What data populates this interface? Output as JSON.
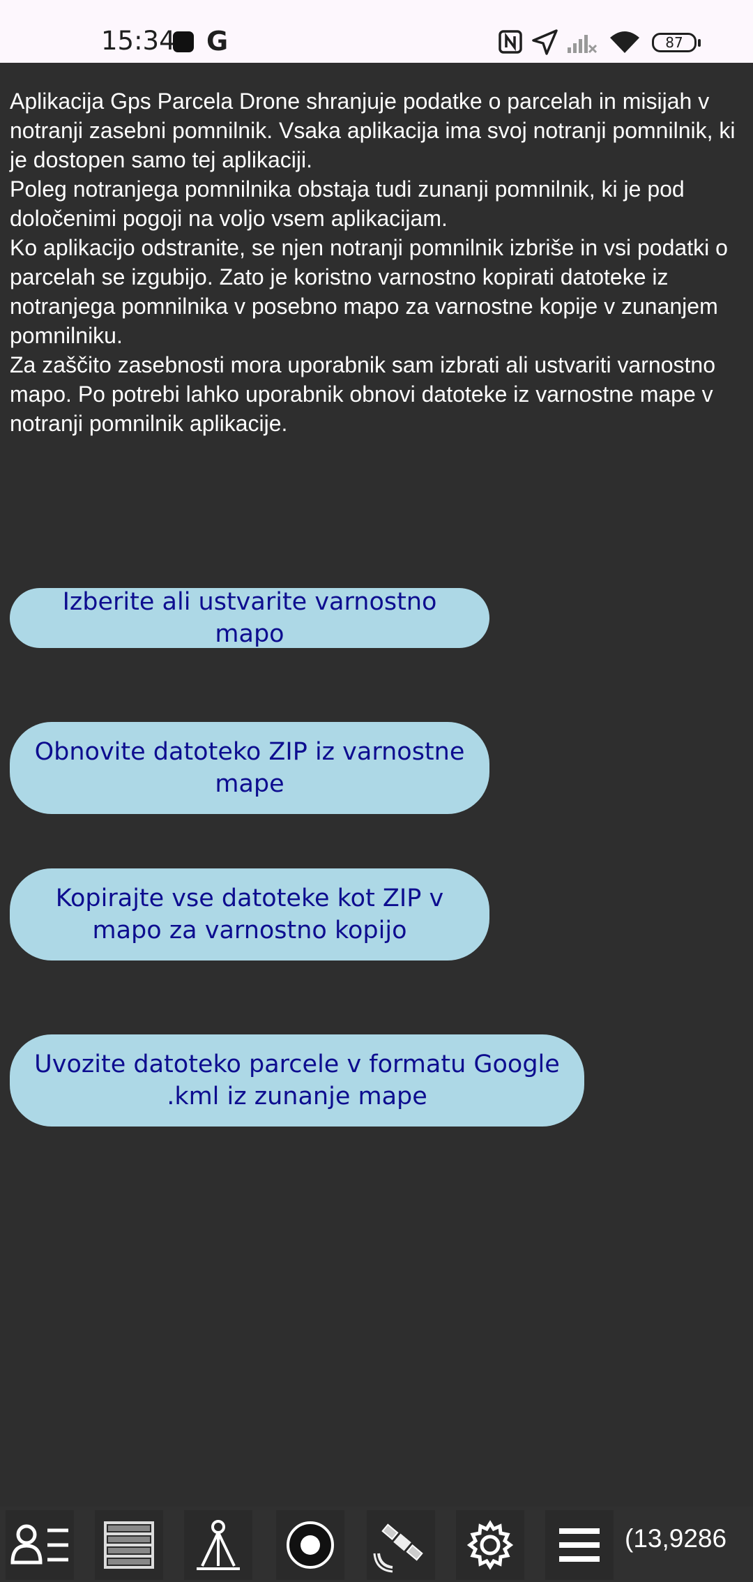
{
  "status_bar": {
    "time": "15:34",
    "g_label": "G",
    "battery": "87",
    "icons": [
      "notification-square-icon",
      "google-icon",
      "nfc-icon",
      "location-arrow-icon",
      "signal-no-service-icon",
      "wifi-icon",
      "battery-icon"
    ]
  },
  "description": "Aplikacija Gps Parcela Drone shranjuje podatke o parcelah in misijah v notranji zasebni pomnilnik. Vsaka aplikacija ima svoj notranji pomnilnik, ki je dostopen samo tej aplikaciji.\nPoleg notranjega pomnilnika obstaja tudi zunanji pomnilnik, ki je pod določenimi pogoji na voljo vsem aplikacijam.\nKo aplikacijo odstranite, se njen notranji pomnilnik izbriše in vsi podatki o parcelah se izgubijo. Zato je koristno varnostno kopirati datoteke iz notranjega pomnilnika v posebno mapo za varnostne kopije v zunanjem pomnilniku.\nZa zaščito zasebnosti mora uporabnik sam izbrati ali ustvariti varnostno mapo. Po potrebi lahko uporabnik obnovi datoteke iz varnostne mape v notranji pomnilnik aplikacije.",
  "buttons": {
    "select_folder": "Izberite ali ustvarite varnostno mapo",
    "restore_zip": "Obnovite datoteko ZIP iz varnostne mape",
    "copy_zip": "Kopirajte vse datoteke kot ZIP v mapo za varnostno kopijo",
    "import_kml": "Uvozite datoteko parcele v formatu Google .kml iz zunanje mape"
  },
  "colors": {
    "background": "#2e2e2e",
    "button_bg": "#add8e6",
    "button_text": "#0d0d8f",
    "text": "#ffffff"
  },
  "bottom_nav": {
    "items": [
      "user-list-icon",
      "list-icon",
      "survey-tripod-icon",
      "record-icon",
      "satellite-icon",
      "gear-icon",
      "menu-icon"
    ],
    "coordinate_text": "(13,9286"
  }
}
